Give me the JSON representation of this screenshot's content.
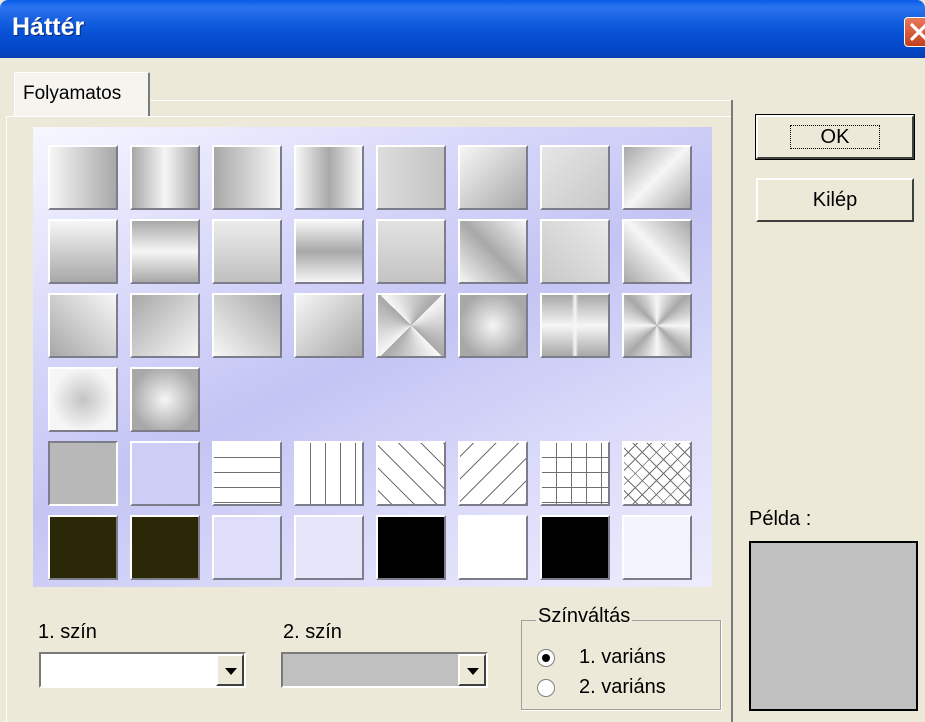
{
  "window": {
    "title": "Háttér"
  },
  "tab": {
    "label": "Folyamatos"
  },
  "color1": {
    "label": "1. szín",
    "value": ""
  },
  "color2": {
    "label": "2. szín",
    "value": ""
  },
  "variant": {
    "title": "Színváltás",
    "options": [
      "1. variáns",
      "2. variáns"
    ],
    "selected": 0
  },
  "buttons": {
    "ok": "OK",
    "cancel": "Kilép"
  },
  "preview": {
    "label": "Példa :"
  },
  "colors": {
    "titlebar": "#0a55d8",
    "face": "#ece9d8",
    "preview": "#c0c0c0",
    "gallery": "#d6d6fa"
  },
  "gallery_rows": [
    [
      "grad-h",
      "grad-h-center",
      "grad-h-rev",
      "grad-h-center-rev",
      "grad-h-light",
      "grad-diag",
      "grad-diag-light",
      "grad-diag-band"
    ],
    [
      "grad-v",
      "grad-v-center",
      "grad-v-light",
      "grad-v-center-rev",
      "grad-v-soft",
      "grad-diag-rev",
      "grad-diag-rev-light",
      "grad-diag-rev-band"
    ],
    [
      "corner-bl",
      "corner-tl",
      "corner-tr",
      "corner-br",
      "rect-out",
      "rect-in",
      "cross",
      "star"
    ],
    [
      "radial-out",
      "radial-in"
    ],
    [
      "solid-gray",
      "solid-lavender",
      "lines-h",
      "lines-v",
      "lines-diag-f",
      "lines-diag-b",
      "grid",
      "crosshatch"
    ],
    [
      "solid-olive",
      "solid-olive-2",
      "solid-lavender-2",
      "solid-lavender-3",
      "solid-black",
      "solid-white",
      "solid-black-2",
      "solid-whitish"
    ]
  ],
  "selected_tile": "solid-gray"
}
